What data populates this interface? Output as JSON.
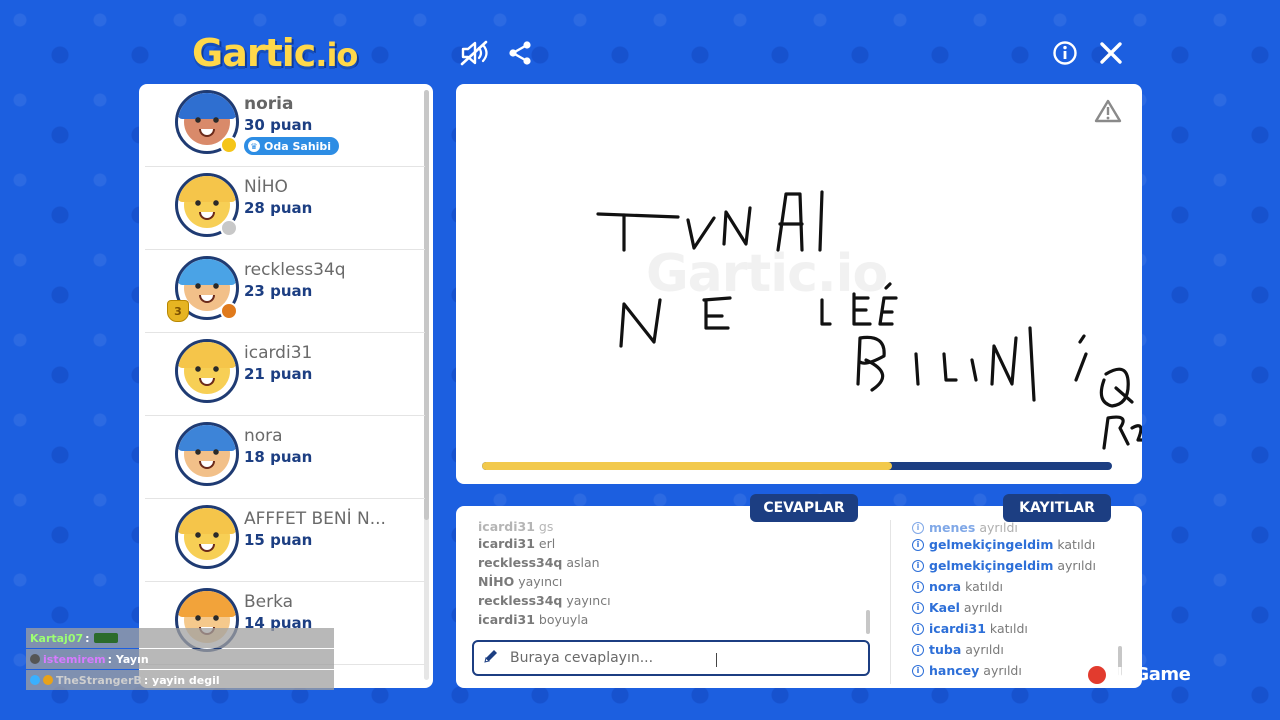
{
  "app": {
    "logo_main": "Gartic",
    "logo_suffix": "io",
    "icons": [
      "mute-icon",
      "share-icon",
      "info-icon",
      "close-icon"
    ]
  },
  "players": [
    {
      "name": "noria",
      "score": "30 puan",
      "owner_badge": "Oda Sahibi",
      "status_color": "#f5c518",
      "hair_color": "#2f6fd0",
      "skin": "#d98a6a"
    },
    {
      "name": "NİHO",
      "score": "28 puan",
      "status_color": "#c8c8c8",
      "hair_color": "#f5c54a",
      "skin": "#f7cf55"
    },
    {
      "name": "reckless34q",
      "score": "23 puan",
      "rank": "3",
      "status_color": "#e07a1c",
      "hair_color": "#4aa3e6",
      "skin": "#f2c089"
    },
    {
      "name": "icardi31",
      "score": "21 puan",
      "hair_color": "#f5c54a",
      "skin": "#f7cf55"
    },
    {
      "name": "nora",
      "score": "18 puan",
      "hair_color": "#3d84d8",
      "skin": "#f2c089"
    },
    {
      "name": "AFFFET BENİ N...",
      "score": "15 puan",
      "hair_color": "#f5c54a",
      "skin": "#f7cf55"
    },
    {
      "name": "Berka",
      "score": "14 puan",
      "hair_color": "#f2a33a",
      "skin": "#f5c98c"
    }
  ],
  "canvas": {
    "watermark": "Gartic.io",
    "drawing_text": [
      "TUNA",
      "NE İLE",
      "BİLİNİR"
    ],
    "timer_progress": 0.65,
    "colors": {
      "timer_fill": "#f2c94c",
      "timer_track": "#1c3e82"
    }
  },
  "tabs": {
    "answers": "CEVAPLAR",
    "logs": "KAYITLAR"
  },
  "answers": [
    {
      "user": "icardi31",
      "text": "gs",
      "faded": true
    },
    {
      "user": "icardi31",
      "text": "erl"
    },
    {
      "user": "reckless34q",
      "text": "aslan"
    },
    {
      "user": "NİHO",
      "text": "yayıncı"
    },
    {
      "user": "reckless34q",
      "text": "yayıncı"
    },
    {
      "user": "icardi31",
      "text": "boyuyla"
    }
  ],
  "answer_input": {
    "placeholder": "Buraya cevaplayın..."
  },
  "logs": [
    {
      "user": "menes",
      "action": "ayrıldı",
      "faded": true
    },
    {
      "user": "gelmekiçingeldim",
      "action": "katıldı"
    },
    {
      "user": "gelmekiçingeldim",
      "action": "ayrıldı"
    },
    {
      "user": "nora",
      "action": "katıldı"
    },
    {
      "user": "Kael",
      "action": "ayrıldı"
    },
    {
      "user": "icardi31",
      "action": "katıldı"
    },
    {
      "user": "tuba",
      "action": "ayrıldı"
    },
    {
      "user": "hancey",
      "action": "ayrıldı"
    }
  ],
  "stream_chat": [
    {
      "user": "Kartaj07",
      "text": ""
    },
    {
      "user": "istemirem",
      "text": "Yayın"
    },
    {
      "user": "TheStrangerB",
      "text": "yayin degil"
    }
  ],
  "overlay_brand": "NoGame"
}
